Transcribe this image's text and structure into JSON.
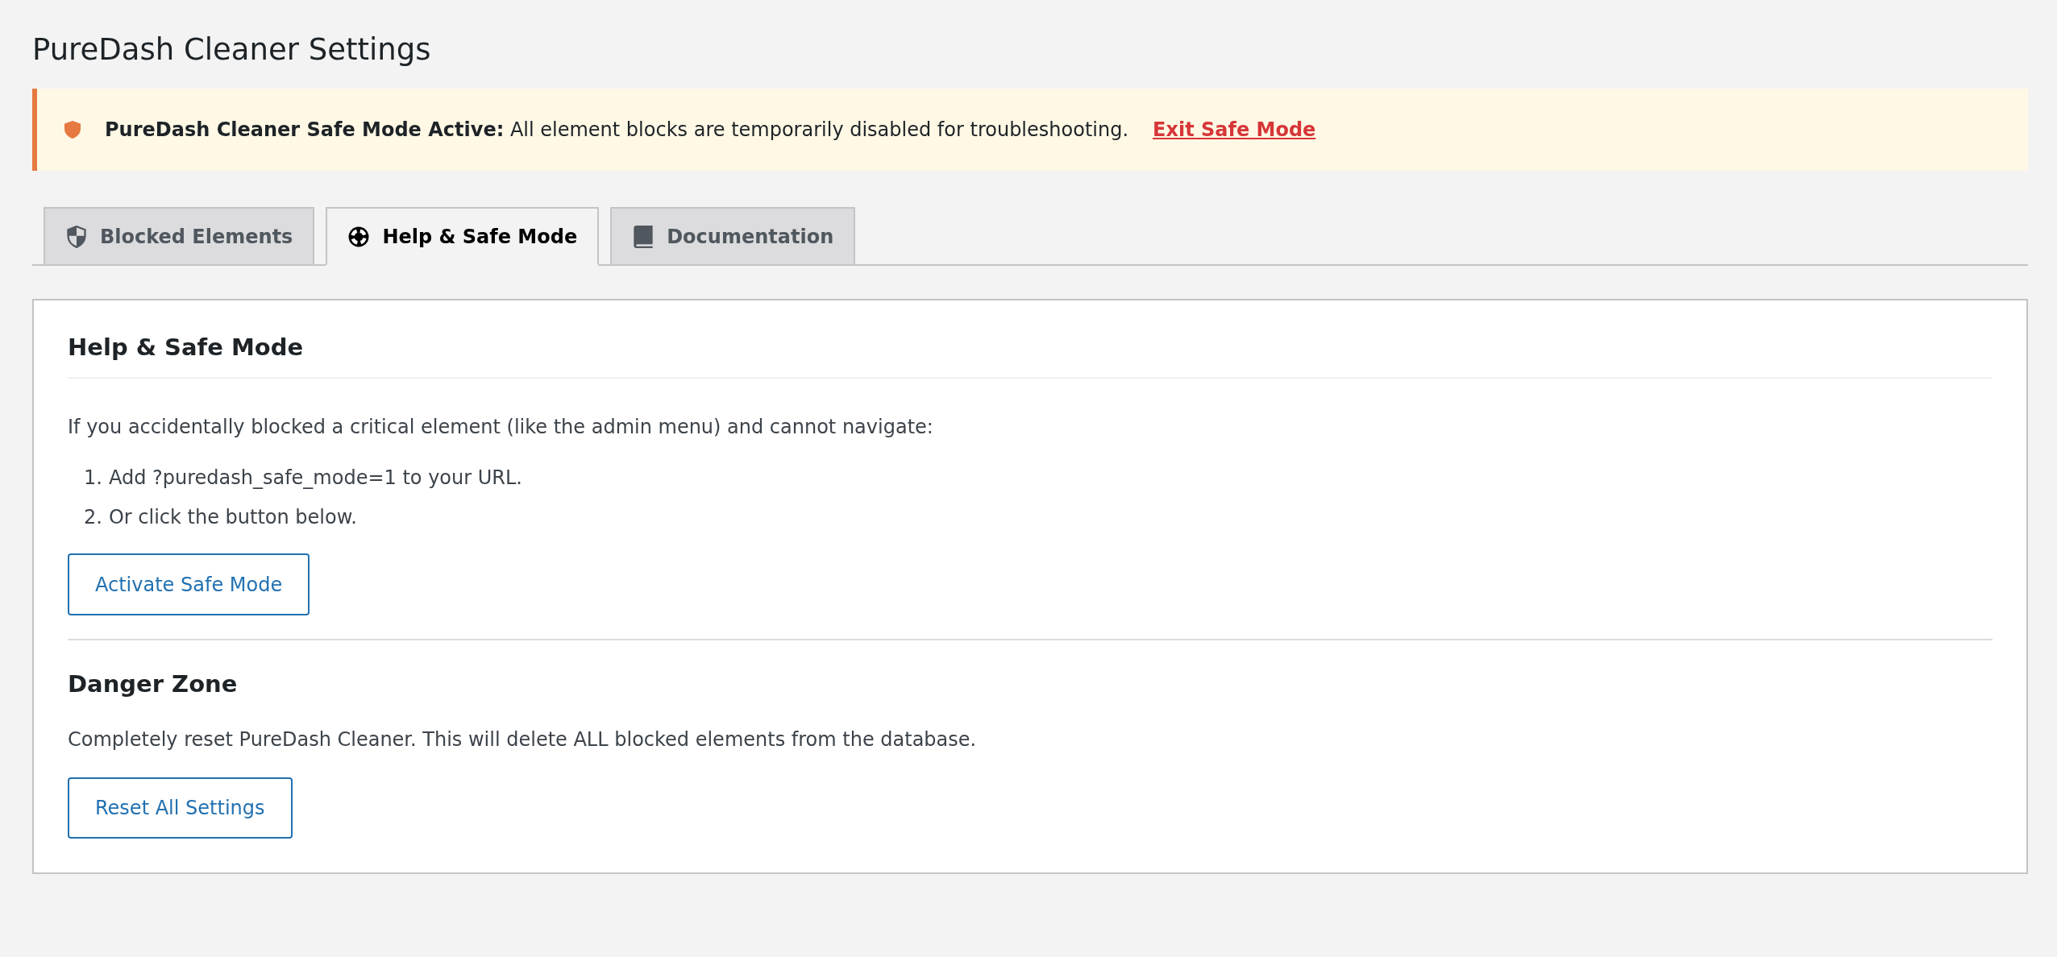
{
  "page": {
    "title": "PureDash Cleaner Settings"
  },
  "notice": {
    "message": "**PureDash Cleaner Safe Mode Active:** All element blocks are temporarily disabled for troubleshooting.",
    "link": "Exit Safe Mode"
  },
  "tabs": [
    {
      "label": "Blocked Elements",
      "selected": false
    },
    {
      "label": "Help & Safe Mode",
      "selected": true
    },
    {
      "label": "Documentation",
      "selected": false
    }
  ],
  "panel": {
    "title": "Help & Safe Mode",
    "intro": "If you accidentally blocked a critical element (like the admin menu) and cannot navigate:",
    "steps": [
      {
        "number": "1.",
        "text": "Add ?puredash_safe_mode=1 to your URL."
      },
      {
        "number": "2.",
        "text": "Or click the button below."
      }
    ],
    "button": "Activate Safe Mode",
    "danger_zone": {
      "title": "Danger Zone",
      "text": "Completely reset PureDash Cleaner. This will delete ALL blocked elements from the database.",
      "button": "Reset All Settings"
    }
  }
}
